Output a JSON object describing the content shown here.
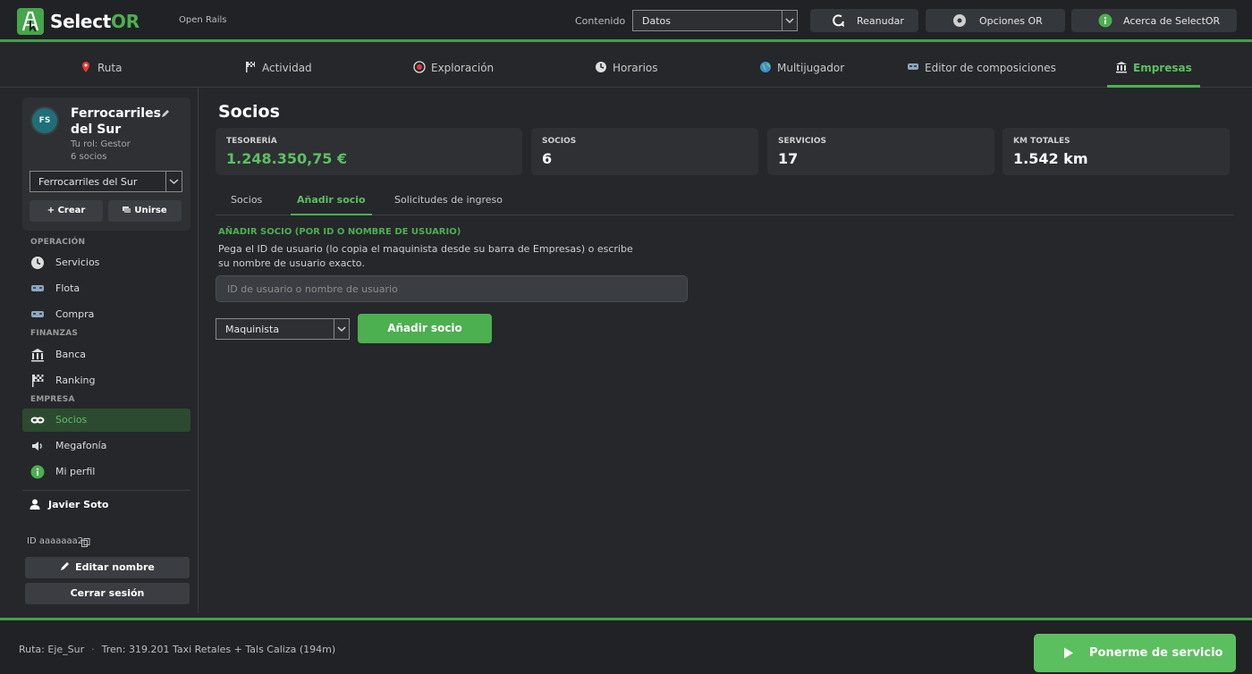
{
  "app": {
    "name_main": "Select",
    "name_accent": "OR",
    "subtitle": "Open Rails"
  },
  "topbar": {
    "content_label": "Contenido",
    "content_value": "Datos",
    "buttons": [
      {
        "label": "Reanudar",
        "icon": "refresh-icon"
      },
      {
        "label": "Opciones OR",
        "icon": "gear-icon"
      },
      {
        "label": "Acerca de SelectOR",
        "icon": "info-icon"
      }
    ]
  },
  "tabs": [
    {
      "label": "Ruta",
      "icon": "map-pin-icon"
    },
    {
      "label": "Actividad",
      "icon": "flag-icon"
    },
    {
      "label": "Exploración",
      "icon": "compass-icon"
    },
    {
      "label": "Horarios",
      "icon": "clock-icon"
    },
    {
      "label": "Multijugador",
      "icon": "globe-icon"
    },
    {
      "label": "Editor de composiciones",
      "icon": "train-icon"
    },
    {
      "label": "Empresas",
      "icon": "bank-icon",
      "active": true
    }
  ],
  "sidebar": {
    "company": {
      "initials": "FS",
      "name": "Ferrocarriles del Sur",
      "role": "Tu rol: Gestor",
      "members": "6 socios",
      "selected": "Ferrocarriles del Sur",
      "create_label": "+ Crear",
      "join_label": "Unirse"
    },
    "sections": {
      "operacion": "OPERACIÓN",
      "finanzas": "FINANZAS",
      "empresa": "EMPRESA"
    },
    "items": [
      {
        "label": "Servicios",
        "icon": "clock-icon"
      },
      {
        "label": "Flota",
        "icon": "train-icon"
      },
      {
        "label": "Compra",
        "icon": "train-icon"
      },
      {
        "label": "Banca",
        "icon": "bank-icon"
      },
      {
        "label": "Ranking",
        "icon": "checkered-flag-icon"
      },
      {
        "label": "Socios",
        "icon": "link-icon",
        "active": true
      },
      {
        "label": "Megafonía",
        "icon": "speaker-icon"
      },
      {
        "label": "Mi perfil",
        "icon": "info-icon"
      }
    ],
    "user": {
      "name": "Javier Soto",
      "id": "ID aaaaaaa2",
      "edit_label": "Editar nombre",
      "logout_label": "Cerrar sesión"
    }
  },
  "main": {
    "title": "Socios",
    "stats": [
      {
        "label": "TESORERÍA",
        "value": "1.248.350,75 €",
        "highlight": true
      },
      {
        "label": "SOCIOS",
        "value": "6"
      },
      {
        "label": "SERVICIOS",
        "value": "17"
      },
      {
        "label": "KM TOTALES",
        "value": "1.542 km"
      }
    ],
    "subtabs": [
      {
        "label": "Socios"
      },
      {
        "label": "Añadir socio",
        "active": true
      },
      {
        "label": "Solicitudes de ingreso"
      }
    ],
    "form": {
      "title": "AÑADIR SOCIO (POR ID O NOMBRE DE USUARIO)",
      "description": "Pega el ID de usuario (lo copia el maquinista desde su barra de Empresas) o escribe su nombre de usuario exacto.",
      "input_placeholder": "ID de usuario o nombre de usuario",
      "input_value": "",
      "role_value": "Maquinista",
      "submit_label": "Añadir socio"
    }
  },
  "bottombar": {
    "route": "Ruta: Eje_Sur",
    "separator": "·",
    "train": "Tren: 319.201 Taxi Retales + Tals Caliza (194m)",
    "service_label": "Ponerme de servicio"
  },
  "colors": {
    "accent": "#4caf50",
    "background": "#25272a",
    "bar": "#202225"
  }
}
